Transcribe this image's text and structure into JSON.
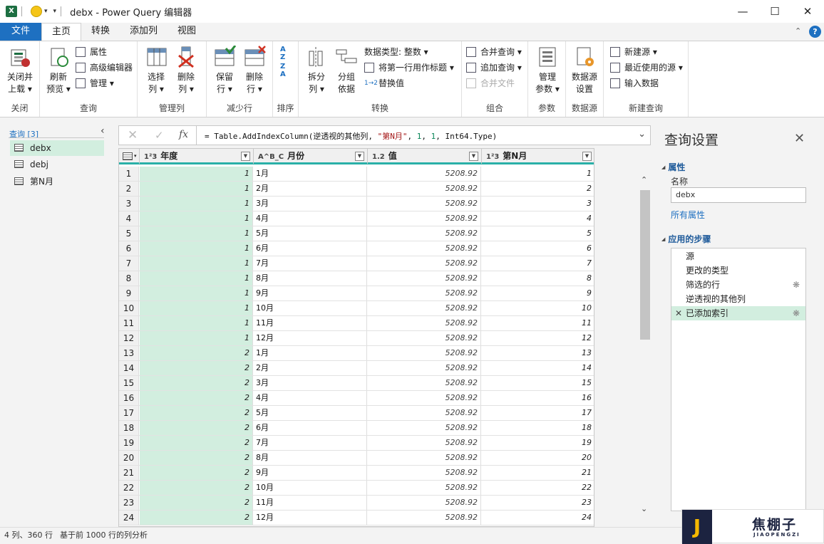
{
  "titlebar": {
    "app_icon": "X",
    "window_title": "debx - Power Query 编辑器",
    "dropdown_glyph": "▾"
  },
  "ribbon_tabs": {
    "file": "文件",
    "home": "主页",
    "transform": "转换",
    "add_column": "添加列",
    "view": "视图"
  },
  "ribbon": {
    "close": {
      "label1": "关闭并",
      "label2": "上载 ▾",
      "group": "关闭"
    },
    "query": {
      "refresh1": "刷新",
      "refresh2": "预览 ▾",
      "properties": "属性",
      "advanced": "高级编辑器",
      "manage": "管理 ▾",
      "group": "查询"
    },
    "manage_cols": {
      "choose1": "选择",
      "choose2": "列 ▾",
      "remove1": "删除",
      "remove2": "列 ▾",
      "group": "管理列"
    },
    "reduce_rows": {
      "keep1": "保留",
      "keep2": "行 ▾",
      "remove1": "删除",
      "remove2": "行 ▾",
      "group": "减少行"
    },
    "sort": {
      "group": "排序"
    },
    "transform": {
      "split1": "拆分",
      "split2": "列 ▾",
      "groupby1": "分组",
      "groupby2": "依据",
      "datatype": "数据类型: 整数 ▾",
      "first_row": "将第一行用作标题 ▾",
      "replace": "替换值",
      "group": "转换"
    },
    "combine": {
      "merge": "合并查询 ▾",
      "append": "追加查询 ▾",
      "combine_files": "合并文件",
      "group": "组合"
    },
    "params": {
      "manage1": "管理",
      "manage2": "参数 ▾",
      "group": "参数"
    },
    "datasource": {
      "settings1": "数据源",
      "settings2": "设置",
      "group": "数据源"
    },
    "new_query": {
      "new_source": "新建源 ▾",
      "recent": "最近使用的源 ▾",
      "enter_data": "输入数据",
      "group": "新建查询"
    }
  },
  "queries_pane": {
    "header": "查询 [3]",
    "items": [
      "debx",
      "debj",
      "第N月"
    ]
  },
  "formula": {
    "prefix": "= Table.AddIndexColumn(逆透视的其他列, ",
    "str": "\"第N月\"",
    "mid": ", ",
    "n1": "1",
    "n2": "1",
    "end": ", Int64.Type)"
  },
  "columns": [
    {
      "type": "1²3",
      "name": "年度"
    },
    {
      "type": "A^B_C",
      "name": "月份"
    },
    {
      "type": "1.2",
      "name": "值"
    },
    {
      "type": "1²3",
      "name": "第N月"
    }
  ],
  "rows": [
    [
      "1",
      "1",
      "1月",
      "5208.92",
      "1"
    ],
    [
      "2",
      "1",
      "2月",
      "5208.92",
      "2"
    ],
    [
      "3",
      "1",
      "3月",
      "5208.92",
      "3"
    ],
    [
      "4",
      "1",
      "4月",
      "5208.92",
      "4"
    ],
    [
      "5",
      "1",
      "5月",
      "5208.92",
      "5"
    ],
    [
      "6",
      "1",
      "6月",
      "5208.92",
      "6"
    ],
    [
      "7",
      "1",
      "7月",
      "5208.92",
      "7"
    ],
    [
      "8",
      "1",
      "8月",
      "5208.92",
      "8"
    ],
    [
      "9",
      "1",
      "9月",
      "5208.92",
      "9"
    ],
    [
      "10",
      "1",
      "10月",
      "5208.92",
      "10"
    ],
    [
      "11",
      "1",
      "11月",
      "5208.92",
      "11"
    ],
    [
      "12",
      "1",
      "12月",
      "5208.92",
      "12"
    ],
    [
      "13",
      "2",
      "1月",
      "5208.92",
      "13"
    ],
    [
      "14",
      "2",
      "2月",
      "5208.92",
      "14"
    ],
    [
      "15",
      "2",
      "3月",
      "5208.92",
      "15"
    ],
    [
      "16",
      "2",
      "4月",
      "5208.92",
      "16"
    ],
    [
      "17",
      "2",
      "5月",
      "5208.92",
      "17"
    ],
    [
      "18",
      "2",
      "6月",
      "5208.92",
      "18"
    ],
    [
      "19",
      "2",
      "7月",
      "5208.92",
      "19"
    ],
    [
      "20",
      "2",
      "8月",
      "5208.92",
      "20"
    ],
    [
      "21",
      "2",
      "9月",
      "5208.92",
      "21"
    ],
    [
      "22",
      "2",
      "10月",
      "5208.92",
      "22"
    ],
    [
      "23",
      "2",
      "11月",
      "5208.92",
      "23"
    ],
    [
      "24",
      "2",
      "12月",
      "5208.92",
      "24"
    ]
  ],
  "settings": {
    "title": "查询设置",
    "properties": "属性",
    "name_label": "名称",
    "name_value": "debx",
    "all_props": "所有属性",
    "applied_steps": "应用的步骤",
    "steps": [
      "源",
      "更改的类型",
      "筛选的行",
      "逆透视的其他列",
      "已添加索引"
    ]
  },
  "status": {
    "left": "4 列、360 行",
    "right": "基于前 1000 行的列分析"
  },
  "watermark": {
    "letter": "J",
    "name": "焦棚子",
    "sub": "JIAOPENGZI"
  },
  "colors": {
    "accent": "#1e70c1",
    "selected": "#d2eedf",
    "header_line": "#2ab0a8"
  }
}
